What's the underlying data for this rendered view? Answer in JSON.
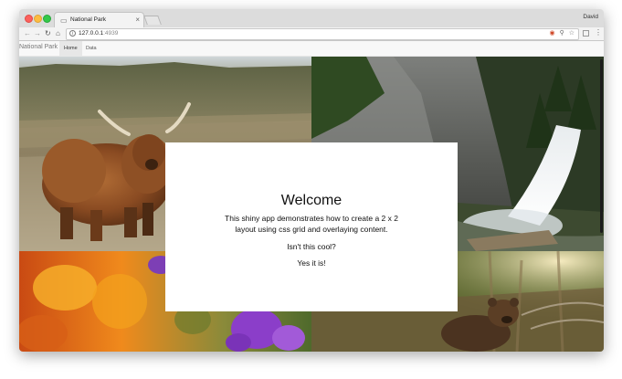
{
  "browser": {
    "tab_title": "National Park",
    "profile_name": "David",
    "url_host": "127.0.0.1",
    "url_port": ":4939"
  },
  "app": {
    "brand": "National Park",
    "nav_tabs": [
      {
        "label": "Home",
        "active": true
      },
      {
        "label": "Data",
        "active": false
      }
    ]
  },
  "images": [
    {
      "name": "highland-cow-photo"
    },
    {
      "name": "waterfall-photo"
    },
    {
      "name": "wildflowers-photo"
    },
    {
      "name": "bear-cub-photo"
    }
  ],
  "overlay": {
    "title": "Welcome",
    "text": "This shiny app demonstrates how to create a 2 x 2 layout using css grid and overlaying content.",
    "question": "Isn't this cool?",
    "answer": "Yes it is!"
  },
  "colors": {
    "traffic_close": "#fc605c",
    "traffic_min": "#fdbc40",
    "traffic_max": "#34c84a",
    "active_tab_bg": "#e7e7e7"
  }
}
